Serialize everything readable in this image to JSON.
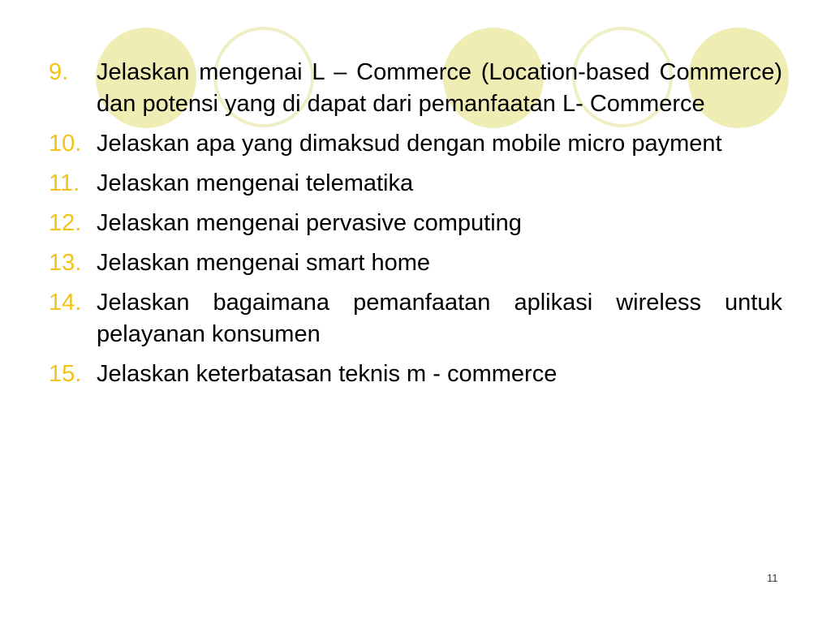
{
  "slide": {
    "accent_color": "#f2c318",
    "circle_color": "#efedb4",
    "items": [
      {
        "number": "9.",
        "text": "Jelaskan mengenai L – Commerce (Location-based Commerce) dan potensi yang di dapat dari pemanfaatan L- Commerce"
      },
      {
        "number": "10.",
        "text": "Jelaskan apa yang dimaksud dengan mobile micro payment"
      },
      {
        "number": "11.",
        "text": "Jelaskan mengenai telematika"
      },
      {
        "number": "12.",
        "text": "Jelaskan mengenai pervasive computing"
      },
      {
        "number": "13.",
        "text": "Jelaskan mengenai smart home"
      },
      {
        "number": "14.",
        "text": "Jelaskan bagaimana pemanfaatan aplikasi wireless untuk pelayanan konsumen"
      },
      {
        "number": "15.",
        "text": "Jelaskan keterbatasan teknis m - commerce"
      }
    ],
    "page_number": "11"
  }
}
